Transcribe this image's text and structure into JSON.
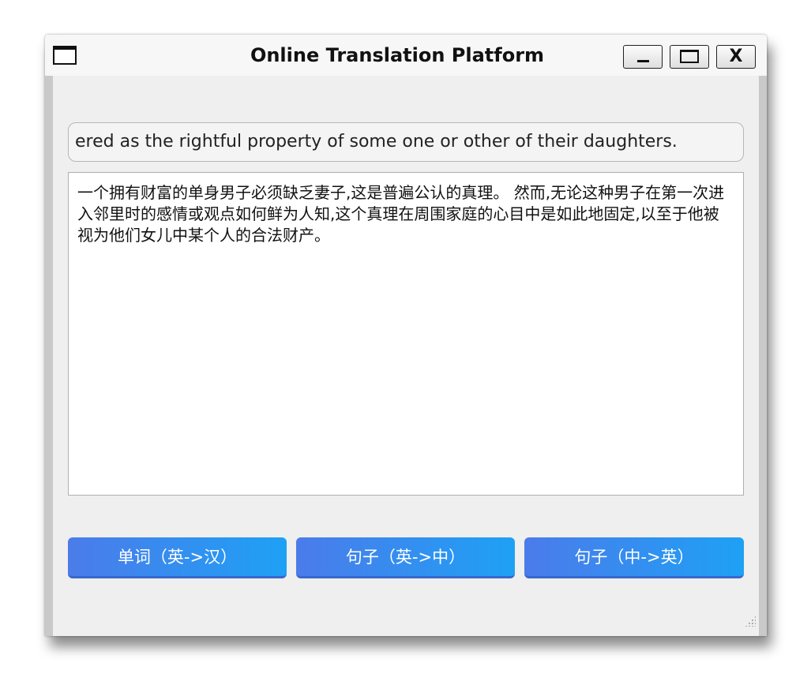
{
  "window": {
    "title": "Online Translation Platform",
    "minimize_glyph": "_",
    "maximize_glyph": "□",
    "close_glyph": "X"
  },
  "input": {
    "value": "ered as the rightful property of some one or other of their daughters."
  },
  "output": {
    "text": "一个拥有财富的单身男子必须缺乏妻子,这是普遍公认的真理。 然而,无论这种男子在第一次进入邻里时的感情或观点如何鲜为人知,这个真理在周围家庭的心目中是如此地固定,以至于他被视为他们女儿中某个人的合法财产。"
  },
  "buttons": {
    "word_en_zh": "单词（英->汉）",
    "sentence_en_zh": "句子（英->中）",
    "sentence_zh_en": "句子（中->英）"
  },
  "colors": {
    "button_gradient_start": "#4b7bea",
    "button_gradient_end": "#1ea1f5",
    "window_background": "#efefef"
  }
}
